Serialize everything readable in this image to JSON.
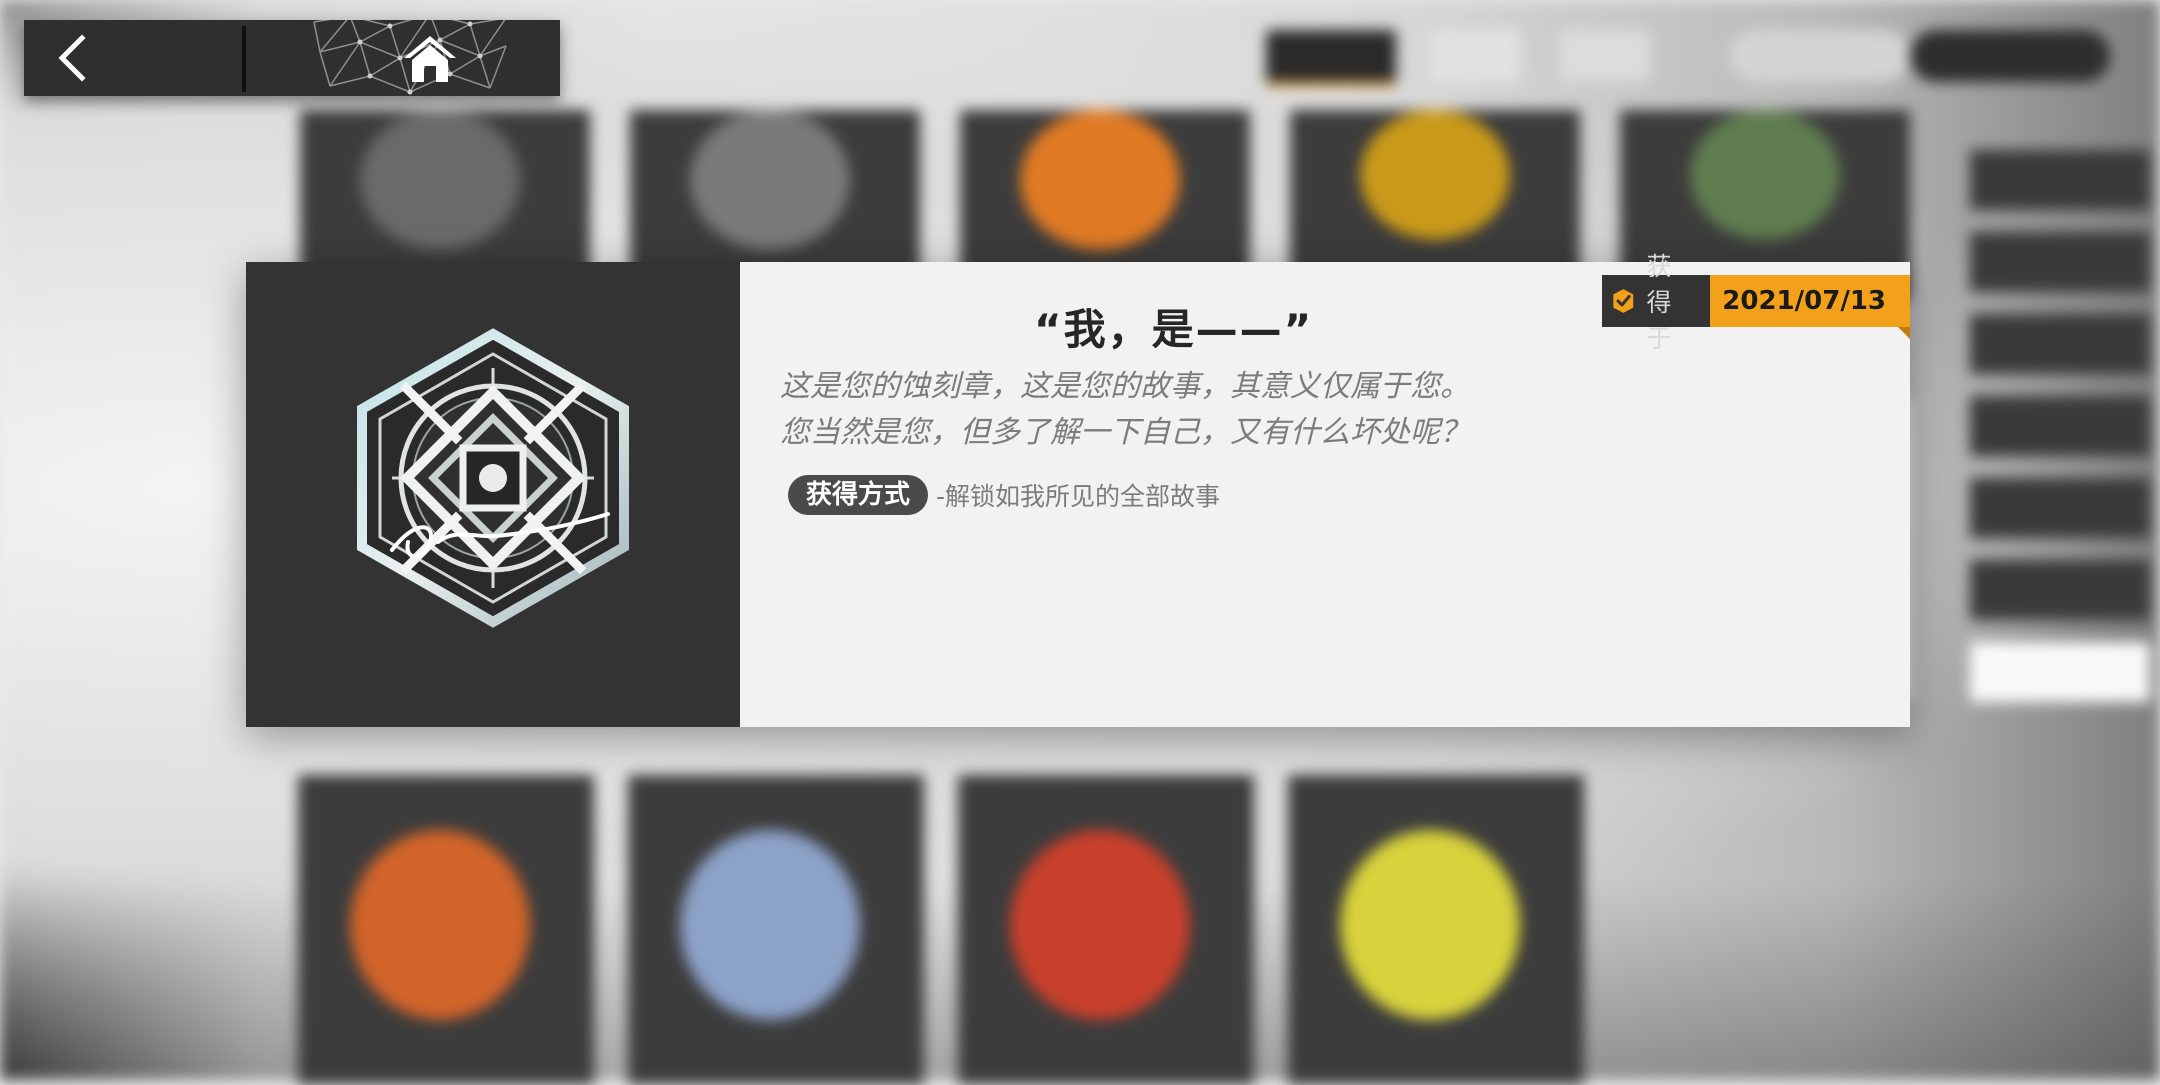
{
  "navigation": {
    "back_icon": "chevron-left-icon",
    "home_icon": "home-icon"
  },
  "badge": {
    "title": "“我，是——”",
    "description_lines": [
      "这是您的蚀刻章，这是您的故事，其意义仅属于您。",
      "您当然是您，但多了解一下自己，又有什么坏处呢？"
    ],
    "obtain_label": "获得方式",
    "obtain_method": "-解锁如我所见的全部故事",
    "acquired_label": "获得于",
    "acquired_date": "2021/07/13",
    "medal_icon": "etched-medal-icon"
  },
  "colors": {
    "accent": "#f3a01b",
    "panel_dark": "#333333",
    "panel_light": "#f2f2f2"
  }
}
